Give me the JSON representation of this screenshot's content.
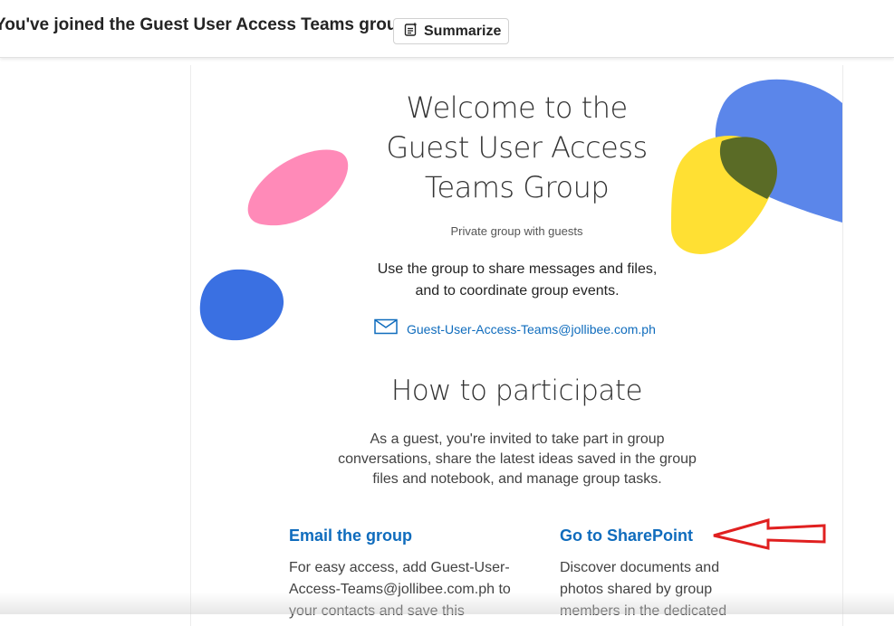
{
  "header": {
    "subject": "You've joined the Guest User Access Teams group",
    "summarize_label": "Summarize"
  },
  "welcome": {
    "title_lines": [
      "Welcome to the",
      "Guest User Access",
      "Teams Group"
    ],
    "privacy": "Private group with guests",
    "description_lines": [
      "Use the group to share messages and files,",
      "and to coordinate group events."
    ],
    "email": "Guest-User-Access-Teams@jollibee.com.ph"
  },
  "participate": {
    "title": "How to participate",
    "text_lines": [
      "As a guest, you're invited to take part in group",
      "conversations, share the latest ideas saved in the group",
      "files and notebook, and manage group tasks."
    ]
  },
  "columns": [
    {
      "title": "Email the group",
      "text_lines": [
        "For easy access, add Guest-User-",
        "Access-Teams@jollibee.com.ph to",
        "your contacts and save this"
      ]
    },
    {
      "title": "Go to SharePoint",
      "text_lines": [
        "Discover documents and",
        "photos shared by group",
        "members in the dedicated"
      ]
    }
  ],
  "colors": {
    "link": "#0f6cbd",
    "blob_pink": "#ff8ab8",
    "blob_blue": "#3a70e2",
    "blob_light_blue": "#5b86ea",
    "blob_yellow": "#ffe033",
    "blob_overlap": "#5a6b26",
    "annotation_arrow": "#e02020"
  }
}
